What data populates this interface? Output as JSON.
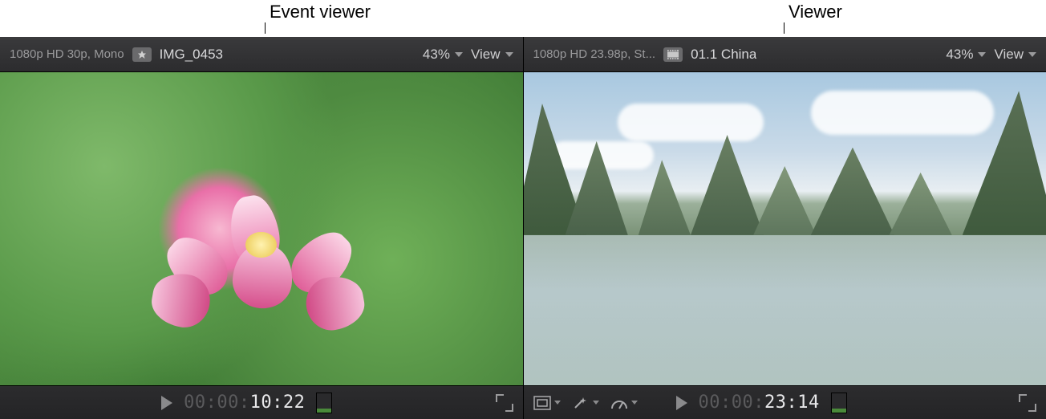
{
  "callouts": {
    "left": "Event viewer",
    "right": "Viewer"
  },
  "event_viewer": {
    "format": "1080p HD 30p, Mono",
    "clip_icon": "favorite-clip-icon",
    "clip_name": "IMG_0453",
    "zoom": "43%",
    "view_label": "View",
    "timecode_dim": "00:00:",
    "timecode_bright": "10:22"
  },
  "viewer": {
    "format": "1080p HD 23.98p, St...",
    "clip_icon": "project-clip-icon",
    "clip_name": "01.1 China",
    "zoom": "43%",
    "view_label": "View",
    "timecode_dim": "00:00:",
    "timecode_bright": "23:14"
  },
  "colors": {
    "toolbar_bg": "#2c2c2e",
    "text_dim": "#9a9a9c",
    "text_bright": "#e8e8ea"
  }
}
